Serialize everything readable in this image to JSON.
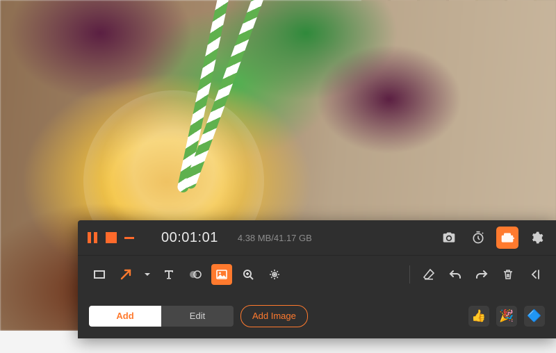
{
  "recorder": {
    "timer": "00:01:01",
    "storage": "4.38 MB/41.17 GB"
  },
  "buttons": {
    "add": "Add",
    "edit": "Edit",
    "add_image": "Add Image"
  },
  "stickers": [
    "👍",
    "🎉",
    "🔷"
  ]
}
